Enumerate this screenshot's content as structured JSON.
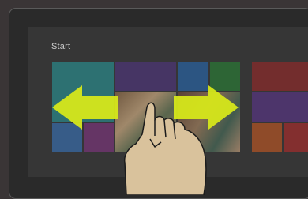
{
  "start_screen": {
    "title": "Start"
  },
  "gesture": {
    "type": "horizontal-swipe",
    "icons": [
      "swipe-left-arrow-icon",
      "swipe-right-arrow-icon",
      "hand-icon"
    ]
  },
  "colors": {
    "arrow": "#d6e71a",
    "hand": "#d9c29c",
    "outline": "#1b1b1b"
  }
}
